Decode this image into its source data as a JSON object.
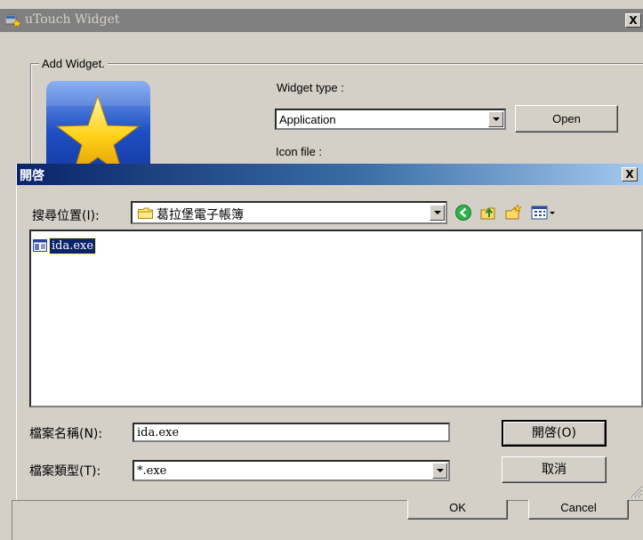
{
  "back_window": {
    "title": "uTouch Widget",
    "close_glyph": "X",
    "group_label": "Add Widget.",
    "widget_type_label": "Widget type :",
    "widget_type_value": "Application",
    "open_button": "Open",
    "icon_file_label": "Icon file :",
    "ok_button": "OK",
    "cancel_button": "Cancel"
  },
  "open_dialog": {
    "title": "開啓",
    "help_glyph": "?",
    "close_glyph": "X",
    "look_in_label": "搜尋位置(I):",
    "look_in_value": "葛拉堡電子帳簿",
    "toolbar_icons": [
      "back-icon",
      "up-folder-icon",
      "new-folder-icon",
      "view-menu-icon"
    ],
    "files": [
      {
        "name": "ida.exe",
        "icon": "exe-file-icon",
        "selected": true
      }
    ],
    "file_name_label": "檔案名稱(N):",
    "file_name_value": "ida.exe",
    "file_type_label": "檔案類型(T):",
    "file_type_value": "*.exe",
    "open_button": "開啓(O)",
    "cancel_button": "取消"
  },
  "colors": {
    "title_active_start": "#0a246a",
    "title_active_end": "#a6caf0",
    "title_inactive": "#808080",
    "face": "#d4d0c8",
    "selection": "#0a246a"
  }
}
